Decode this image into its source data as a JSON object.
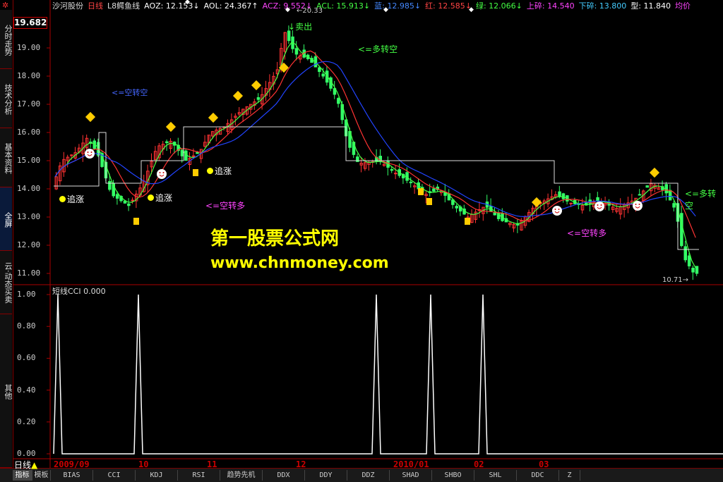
{
  "header": {
    "stock_name": "沙河股份",
    "period": "日线",
    "indicator": "L8鳄鱼线",
    "values": [
      {
        "label": "AOZ:",
        "value": "12.153↓",
        "color": "#ffffff"
      },
      {
        "label": "AOL:",
        "value": "24.367↑",
        "color": "#ffffff"
      },
      {
        "label": "ACZ:",
        "value": "9.552↓",
        "color": "#ff44ff"
      },
      {
        "label": "ACL:",
        "value": "15.913↓",
        "color": "#44ff44"
      },
      {
        "label": "蓝:",
        "value": "12.985↓",
        "color": "#4488ff"
      },
      {
        "label": "红:",
        "value": "12.585↓",
        "color": "#ff4444"
      },
      {
        "label": "绿:",
        "value": "12.066↓",
        "color": "#44ff44"
      },
      {
        "label": "上碎:",
        "value": "14.540",
        "color": "#ff44ff"
      },
      {
        "label": "下碎:",
        "value": "13.800",
        "color": "#44ccff"
      },
      {
        "label": "型:",
        "value": "11.840",
        "color": "#ffffff"
      },
      {
        "label": "均价",
        "value": "",
        "color": "#ff44ff"
      }
    ]
  },
  "sidebar": {
    "tabs": [
      "分时走势",
      "技术分析",
      "基本资料",
      "全屏",
      "云·动态买卖",
      "其他"
    ],
    "active": 3
  },
  "price_box": "19.682",
  "main_chart": {
    "y_ticks": [
      "19.00",
      "18.00",
      "17.00",
      "16.00",
      "15.00",
      "14.00",
      "13.00",
      "12.00",
      "11.00"
    ],
    "y_values": [
      19,
      18,
      17,
      16,
      15,
      14,
      13,
      12,
      11
    ],
    "high_label": "20.33",
    "low_label": "10.71",
    "annotations": [
      {
        "text": "<=空转空",
        "color": "#4466ff"
      },
      {
        "text": "<=多转空",
        "color": "#44ff44"
      },
      {
        "text": "<=空转多",
        "color": "#ff44ff"
      },
      {
        "text": "<=空转多",
        "color": "#ff44ff"
      },
      {
        "text": "<=多转空",
        "color": "#44ff44"
      },
      {
        "text": "追涨",
        "color": "#ffffff"
      },
      {
        "text": "追涨",
        "color": "#ffffff"
      },
      {
        "text": "追涨",
        "color": "#ffffff"
      },
      {
        "text": "卖出",
        "color": "#44ff44"
      }
    ]
  },
  "watermark": {
    "line1": "第一股票公式网",
    "line2": "www.chnmoney.com"
  },
  "sub_chart": {
    "title": "短线CCI",
    "value": "0.000",
    "y_ticks": [
      "1.00",
      "0.80",
      "0.60",
      "0.40",
      "0.20",
      "0.00"
    ],
    "y_values": [
      1.0,
      0.8,
      0.6,
      0.4,
      0.2,
      0.0
    ],
    "spike_dates": [
      "2009-09 early",
      "2009-10 early",
      "2010-01 mid",
      "2010-02 early",
      "2010-02 mid"
    ]
  },
  "date_axis": [
    "2009/09",
    "10",
    "11",
    "12",
    "2010/01",
    "02",
    "03"
  ],
  "bottom_bar": {
    "period_label": "日线",
    "tabs": [
      "指标",
      "模板",
      "BIAS",
      "CCI",
      "KDJ",
      "RSI",
      "趋势先机",
      "DDX",
      "DDY",
      "DDZ",
      "SHAD",
      "SHBO",
      "SHL",
      "DDC",
      "Z"
    ],
    "active": 0
  }
}
